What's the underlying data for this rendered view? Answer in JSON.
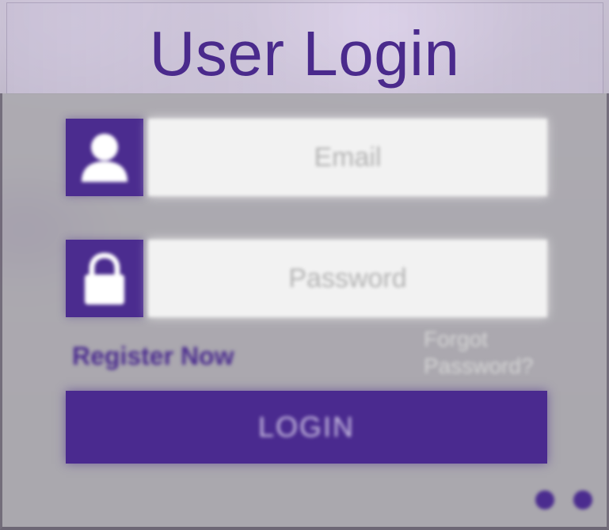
{
  "title": "User Login",
  "form": {
    "email": {
      "icon": "user-icon",
      "placeholder": "Email",
      "value": ""
    },
    "password": {
      "icon": "lock-icon",
      "placeholder": "Password",
      "value": ""
    },
    "register_label": "Register Now",
    "forgot_label": "Forgot Password?",
    "login_label": "LOGIN"
  },
  "colors": {
    "accent": "#4b2c8f",
    "title": "#4a2a8c",
    "input_bg": "#f2f2f2",
    "panel": "#a8a6aa"
  }
}
